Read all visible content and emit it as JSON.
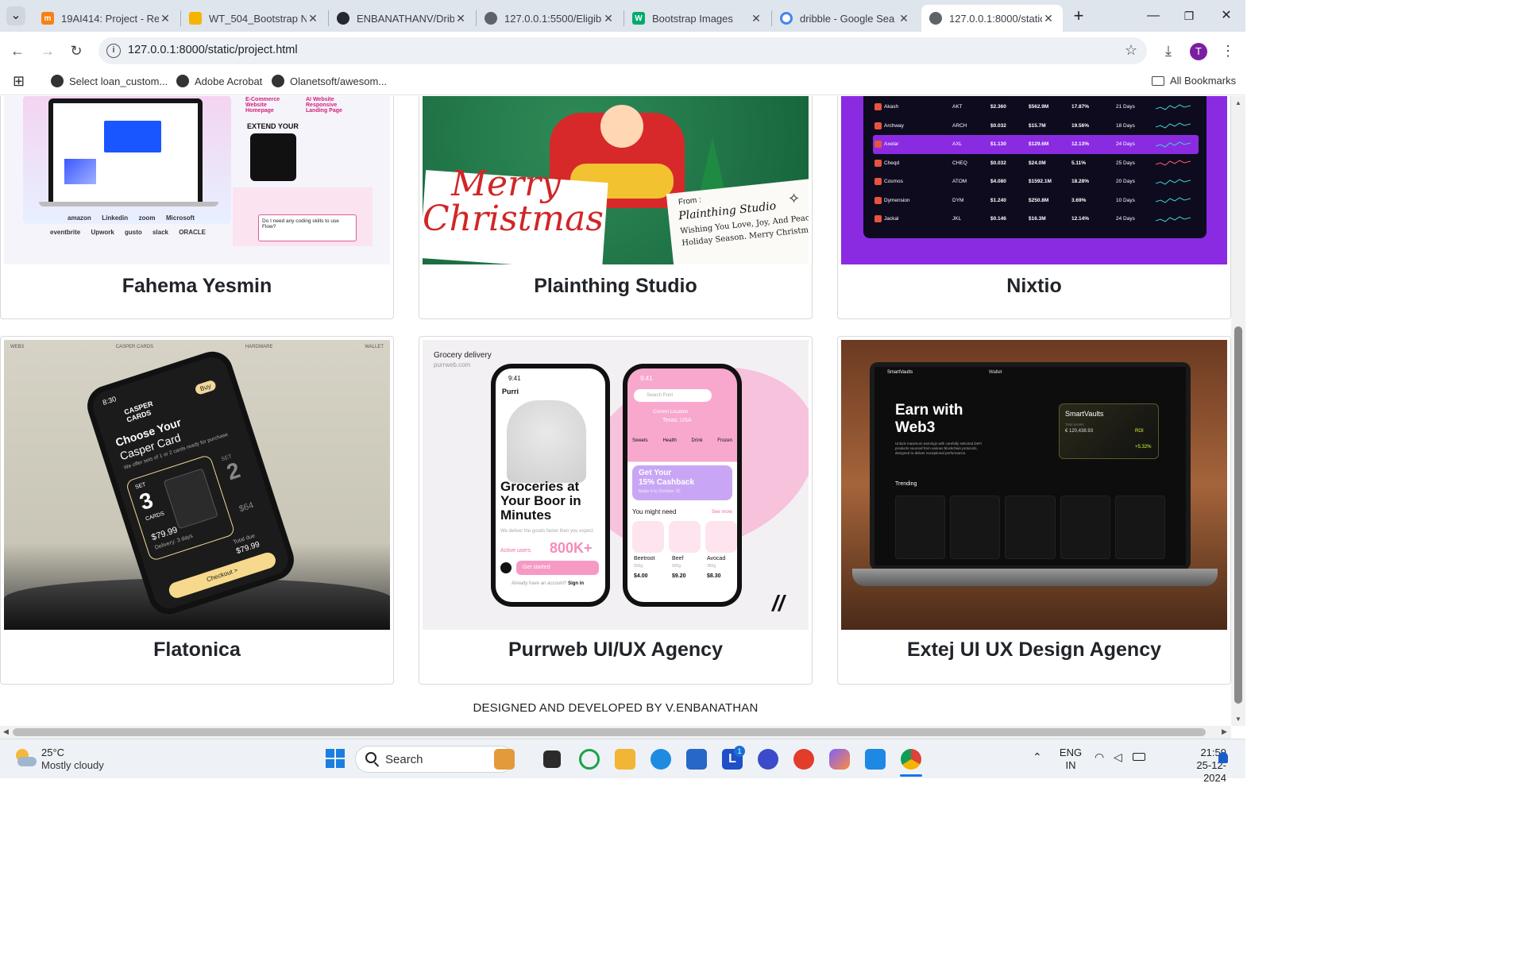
{
  "browser": {
    "tabs": [
      {
        "label": "19AI414: Project - Re",
        "icon": "moodle-icon",
        "color": "#f98012"
      },
      {
        "label": "WT_504_Bootstrap N",
        "icon": "slides-icon",
        "color": "#f4b400"
      },
      {
        "label": "ENBANATHANV/Drib",
        "icon": "github-icon",
        "color": "#24292f"
      },
      {
        "label": "127.0.0.1:5500/Eligib",
        "icon": "globe-icon",
        "color": "#5f6368"
      },
      {
        "label": "Bootstrap Images",
        "icon": "w3schools-icon",
        "color": "#04aa6d"
      },
      {
        "label": "dribble - Google Sea",
        "icon": "google-icon",
        "color": "#4285f4"
      },
      {
        "label": "127.0.0.1:8000/static/",
        "icon": "globe-icon",
        "color": "#5f6368"
      }
    ],
    "new_tab": "+",
    "url": "127.0.0.1:8000/static/project.html",
    "profile_initial": "T",
    "bookmarks": [
      "Select loan_custom...",
      "Adobe Acrobat",
      "Olanetsoft/awesom..."
    ],
    "all_bookmarks": "All Bookmarks"
  },
  "cards": [
    {
      "name": "Fahema Yesmin"
    },
    {
      "name": "Plainthing Studio"
    },
    {
      "name": "Nixtio"
    },
    {
      "name": "Flatonica"
    },
    {
      "name": "Purrweb UI/UX Agency"
    },
    {
      "name": "Extej UI UX Design Agency"
    }
  ],
  "images": {
    "fahema": {
      "logos": [
        "amazon",
        "Linkedin",
        "zoom",
        "Microsoft",
        "eventbrite",
        "Upwork",
        "gusto",
        "slack",
        "ORACLE"
      ],
      "question": "Do I need any coding skills to use Flow?",
      "headline1": "E-Commerce Website Homepage",
      "headline2": "AI Website Responsive Landing Page",
      "promo": "EXTEND YOUR"
    },
    "plainthing": {
      "merry": "Merry",
      "christmas": "Christmas",
      "from": "From :",
      "studio": "Plainthing Studio",
      "wish1": "Wishing You Love, Joy, And Peace This",
      "wish2": "Holiday Season. Merry Christmas!"
    },
    "nixtio": {
      "rows": [
        {
          "name": "Akash",
          "sym": "AKT",
          "price": "$2.360",
          "cap": "$562.9M",
          "pct": "17.87%",
          "days": "21 Days"
        },
        {
          "name": "Archway",
          "sym": "ARCH",
          "price": "$0.032",
          "cap": "$15.7M",
          "pct": "19.56%",
          "days": "18 Days"
        },
        {
          "name": "Axelar",
          "sym": "AXL",
          "price": "$1.130",
          "cap": "$129.6M",
          "pct": "12.13%",
          "days": "24 Days"
        },
        {
          "name": "Cheqd",
          "sym": "CHEQ",
          "price": "$0.032",
          "cap": "$24.0M",
          "pct": "5.11%",
          "days": "25 Days"
        },
        {
          "name": "Cosmos",
          "sym": "ATOM",
          "price": "$4.080",
          "cap": "$1592.1M",
          "pct": "18.28%",
          "days": "20 Days"
        },
        {
          "name": "Dymension",
          "sym": "DYM",
          "price": "$1.240",
          "cap": "$250.8M",
          "pct": "3.69%",
          "days": "10 Days"
        },
        {
          "name": "Jackal",
          "sym": "JKL",
          "price": "$0.146",
          "cap": "$16.3M",
          "pct": "12.14%",
          "days": "24 Days"
        }
      ]
    },
    "flatonica": {
      "top_labels": [
        "WEB3",
        "CASPER CARDS",
        "HARDWARE",
        "WALLET"
      ],
      "time": "8:30",
      "brand": "CASPER CARDS",
      "choose": "Choose Your",
      "card": "Casper Card",
      "offer": "We offer sets of 1 or 2 cards ready for purchase",
      "set3": "3",
      "set2": "2",
      "set_label": "SET",
      "cards_label": "CARDS",
      "price1": "$79.99",
      "price2": "$64",
      "delivery": "Delivery: 3 days",
      "total": "Total due",
      "total_price": "$79.99",
      "checkout": "Checkout >",
      "buy": "Buy"
    },
    "purrweb": {
      "kicker": "Grocery delivery",
      "site": "purrweb.com",
      "time1": "9:41",
      "brand": "Purri",
      "headline": "Groceries at Your Boor in Minutes",
      "sub": "We deliver the goods faster then you expect",
      "active": "Active users",
      "users": "800K+",
      "cta": "Get started",
      "account": "Already have an account?",
      "signin": "Sign in",
      "search": "Search Purri",
      "loc_label": "Current Location",
      "loc": "Texas, USA",
      "cats": [
        "Sweets",
        "Health",
        "Drink",
        "Frozen"
      ],
      "promo1": "Get Your",
      "promo2": "15% Cashback",
      "promo3": "Make it to October 20",
      "might": "You might need",
      "see_more": "See more",
      "items": [
        {
          "name": "Beetroot",
          "weight": "500g",
          "price": "$4.00"
        },
        {
          "name": "Beef",
          "weight": "900g",
          "price": "$9.20"
        },
        {
          "name": "Avocad",
          "weight": "350g",
          "price": "$8.30"
        }
      ]
    },
    "extej": {
      "logo": "SmartVaults",
      "nav": "Wallet",
      "h1": "Earn with",
      "h2": "Web3",
      "desc": "Unlock maximum earnings with carefully selected DeFi products sourced from various blockchain protocols, designed to deliver exceptional performance.",
      "vault": "SmartVaults",
      "vault_label": "Total assets",
      "vault_value": "€ 120,438.93",
      "roi": "ROI",
      "roi_val": "+5.32%",
      "trending": "Trending"
    }
  },
  "footer": "DESIGNED AND DEVELOPED BY V.ENBANATHAN",
  "taskbar": {
    "temp": "25°C",
    "weather": "Mostly cloudy",
    "search": "Search",
    "lang1": "ENG",
    "lang2": "IN",
    "time": "21:59",
    "date": "25-12-2024",
    "badge": "1"
  }
}
